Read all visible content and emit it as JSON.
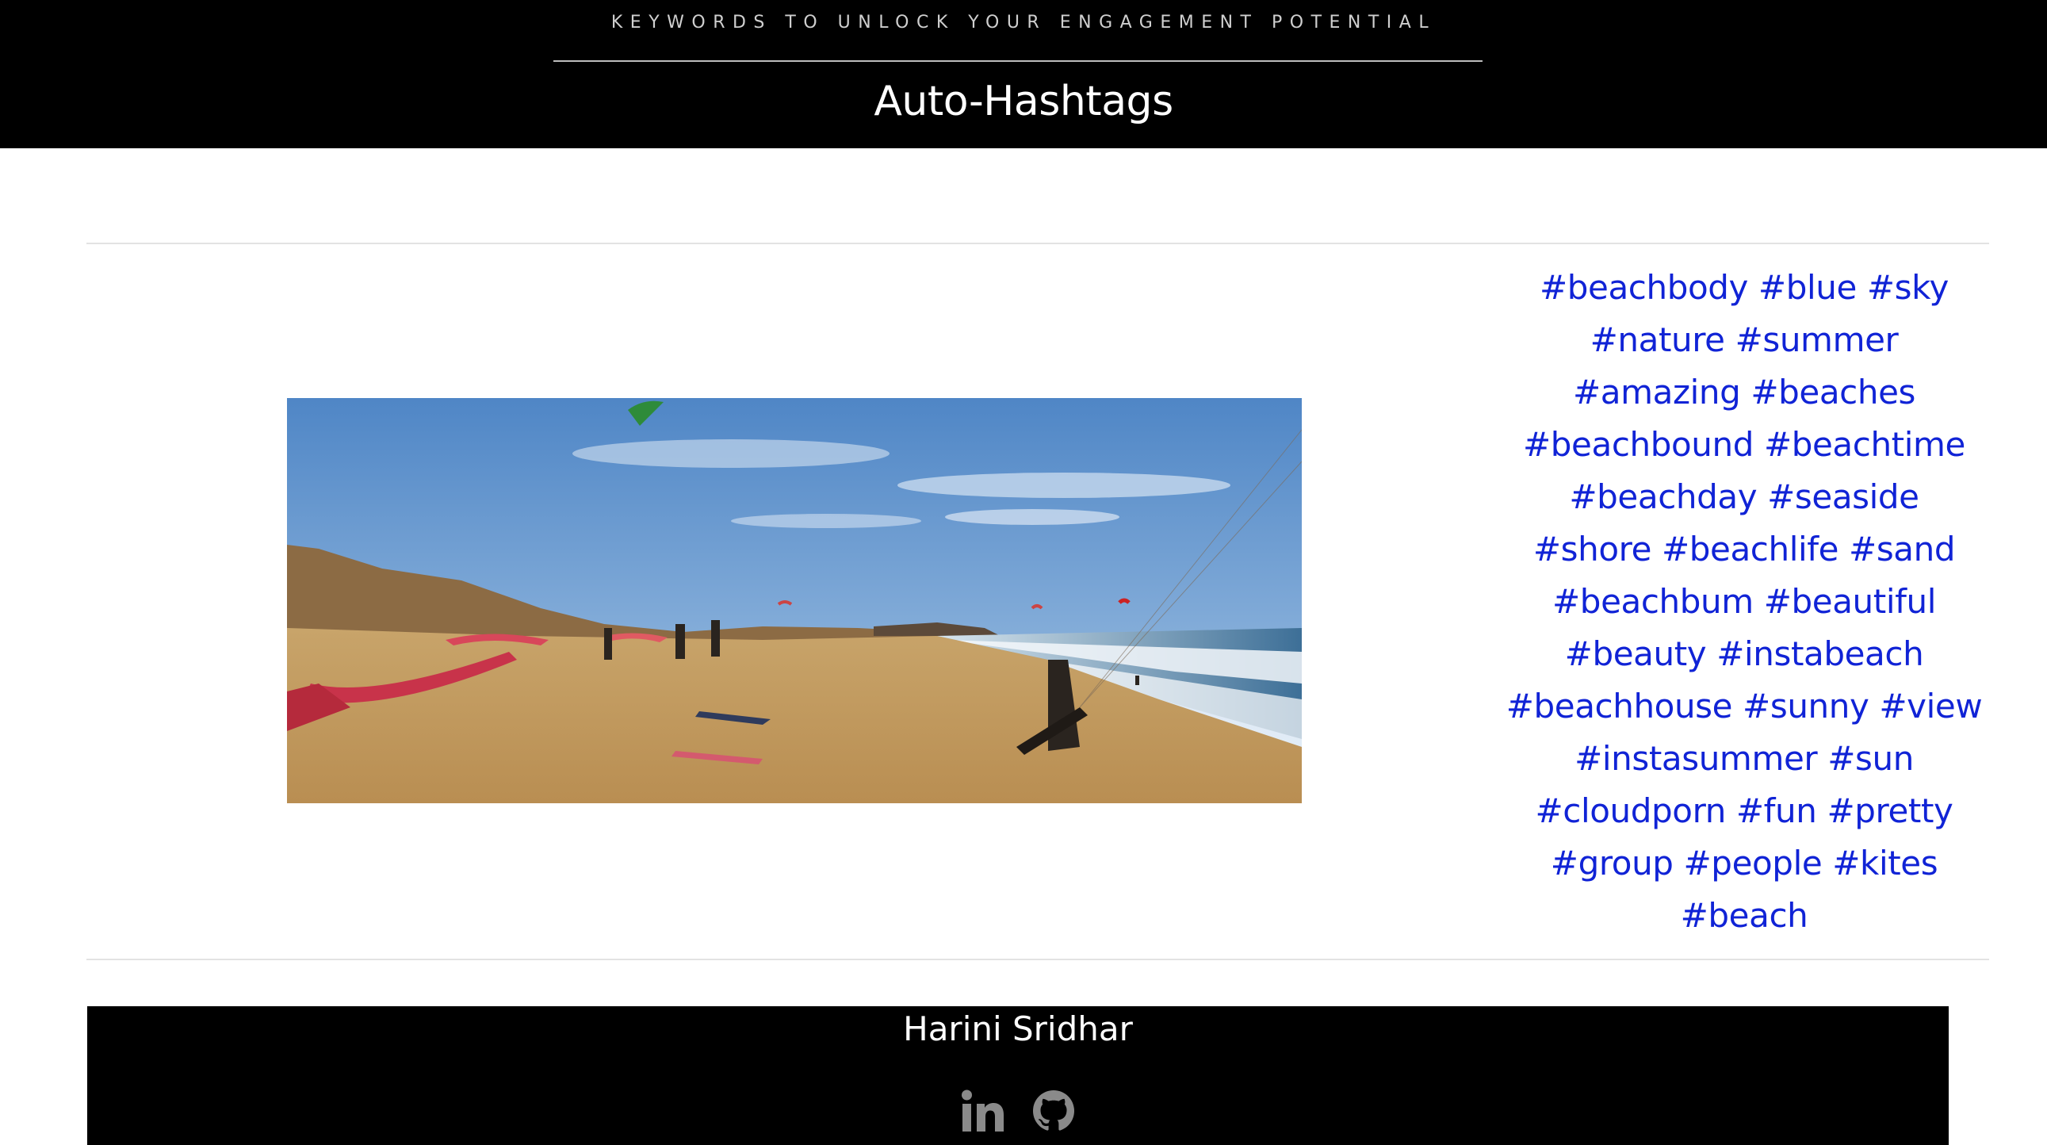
{
  "header": {
    "tagline": "KEYWORDS TO UNLOCK YOUR ENGAGEMENT POTENTIAL",
    "title": "Auto-Hashtags"
  },
  "hashtags": {
    "lines": [
      "#beachbody #blue #sky",
      "#nature #summer",
      "#amazing #beaches",
      "#beachbound #beachtime",
      "#beachday #seaside",
      "#shore #beachlife #sand",
      "#beachbum #beautiful",
      "#beauty #instabeach",
      "#beachhouse #sunny #view",
      "#instasummer #sun",
      "#cloudporn #fun #pretty",
      "#group #people #kites",
      "#beach"
    ],
    "color": "#1023d6"
  },
  "footer": {
    "author": "Harini Sridhar",
    "social_icons": [
      "linkedin-icon",
      "github-icon"
    ],
    "icon_color": "#8a8a8a"
  }
}
